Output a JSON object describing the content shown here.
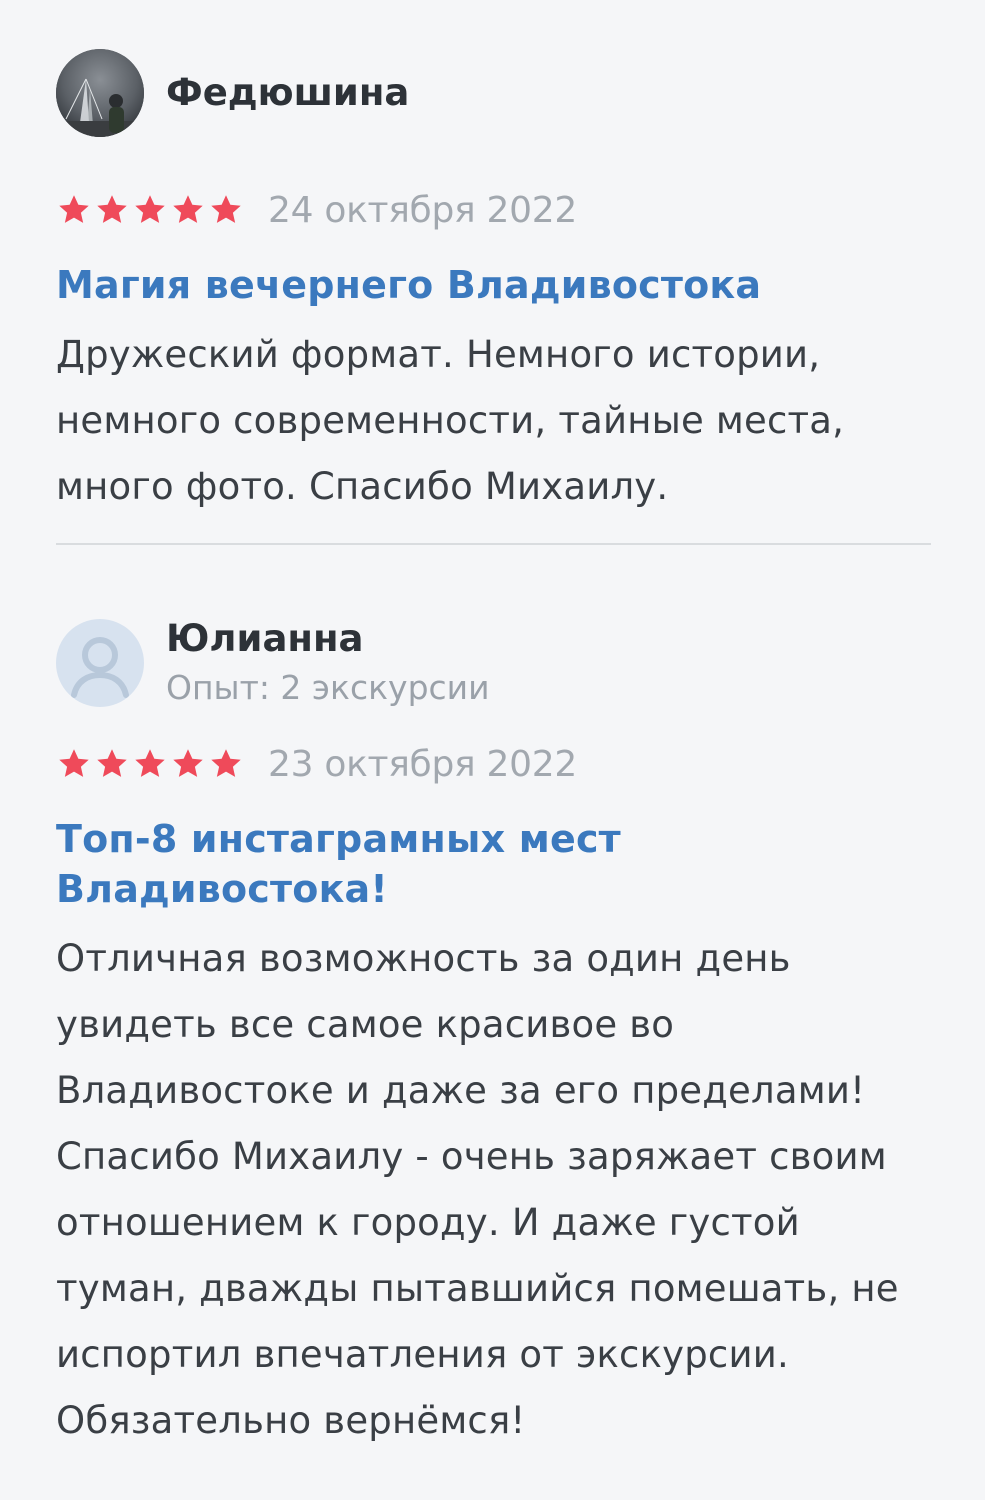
{
  "reviews": [
    {
      "author": "Федюшина",
      "experience": "",
      "avatar_type": "photo",
      "rating": 5,
      "date": "24 октября 2022",
      "tour_title": "Магия вечернего Владивостока",
      "text": "Дружеский формат. Немного истории, немного современности, тайные места, много фото. Спасибо Михаилу."
    },
    {
      "author": "Юлианна",
      "experience": "Опыт: 2 экскурсии",
      "avatar_type": "placeholder",
      "rating": 5,
      "date": "23 октября 2022",
      "tour_title": "Топ-8 инстаграмных мест Владивостока!",
      "text": "Отличная возможность за один день увидеть все самое красивое во Владивостоке и даже за его пределами! Спасибо Михаилу - очень заряжает своим отношением к городу. И даже густой туман, дважды пытавшийся помешать, не испортил впечатления от экскурсии. Обязательно вернёмся!"
    }
  ],
  "colors": {
    "star": "#ef4a5a",
    "title_link": "#3b79be",
    "muted": "#a2a8af",
    "background": "#f5f6f8"
  },
  "icons": {
    "star": "star-icon",
    "user_placeholder": "user-icon"
  }
}
